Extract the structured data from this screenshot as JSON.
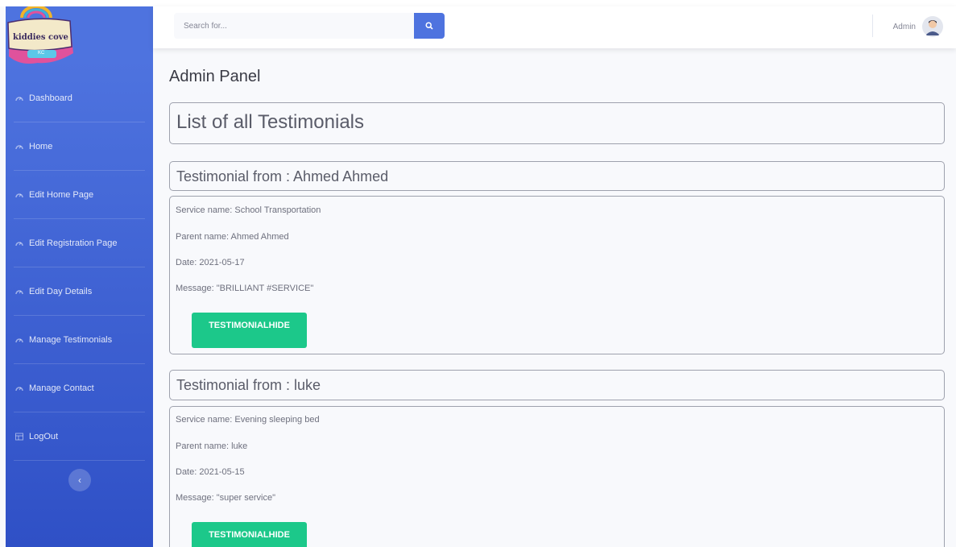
{
  "brand": {
    "logo_text": "kiddies cove",
    "logo_badge": "KC"
  },
  "sidebar": {
    "items": [
      {
        "label": "Dashboard",
        "icon": "tachometer-icon"
      },
      {
        "label": "Home",
        "icon": "tachometer-icon"
      },
      {
        "label": "Edit Home Page",
        "icon": "tachometer-icon"
      },
      {
        "label": "Edit Registration Page",
        "icon": "tachometer-icon"
      },
      {
        "label": "Edit Day Details",
        "icon": "tachometer-icon"
      },
      {
        "label": "Manage Testimonials",
        "icon": "tachometer-icon"
      },
      {
        "label": "Manage Contact",
        "icon": "tachometer-icon"
      },
      {
        "label": "LogOut",
        "icon": "table-icon"
      }
    ],
    "toggle_icon": "chevron-left-icon"
  },
  "topbar": {
    "search_placeholder": "Search for...",
    "search_icon": "search-icon",
    "user_name": "Admin"
  },
  "page": {
    "heading": "Admin Panel",
    "list_title": "List of all Testimonials"
  },
  "testimonials": [
    {
      "header": "Testimonial from : Ahmed Ahmed",
      "service": "Service name: School Transportation",
      "parent": "Parent name: Ahmed Ahmed",
      "date": "Date: 2021-05-17",
      "message": "Message: \"BRILLIANT #SERVICE\"",
      "button": "TESTIMONIALHIDE"
    },
    {
      "header": "Testimonial from : luke",
      "service": "Service name: Evening sleeping bed",
      "parent": "Parent name: luke",
      "date": "Date: 2021-05-15",
      "message": "Message: \"super service\"",
      "button": "TESTIMONIALHIDE"
    }
  ],
  "colors": {
    "sidebar": "#4e73df",
    "accent_green": "#1cc88a",
    "search_button": "#4e73df"
  }
}
